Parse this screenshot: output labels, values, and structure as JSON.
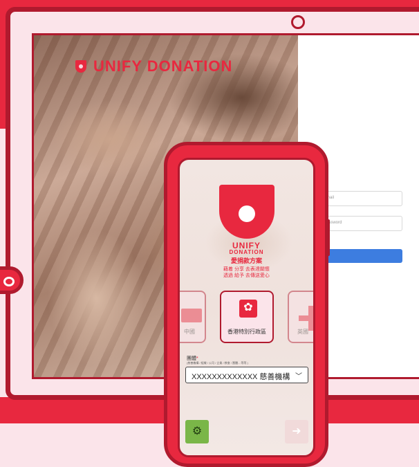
{
  "brand": {
    "logo_text": "UNIFY DONATION",
    "accent_color": "#e8283f",
    "dark_accent": "#b01a2e"
  },
  "login": {
    "email_placeholder": "Email",
    "password_placeholder": "Password"
  },
  "phone": {
    "brand_line1": "UNIFY",
    "brand_line2": "DONATION",
    "brand_line3": "愛捐款方案",
    "tagline1": "藉着 分享 去表達關懷",
    "tagline2": "透過 給予 去傳送愛心",
    "regions": [
      {
        "label": "中國",
        "icon": "china-flag-icon"
      },
      {
        "label": "香港特別行政區",
        "icon": "hong-kong-flag-icon"
      },
      {
        "label": "英國",
        "icon": "plus-cross-icon"
      }
    ],
    "field_label": "團體",
    "field_required": "*",
    "field_hint": "(慈善機構 / 組織 / 公司 / 企業 / 教會 / 團體....等等 )",
    "selected_org": "XXXXXXXXXXXXX 慈善機構",
    "settings_icon": "gear-icon",
    "next_icon": "arrow-right-icon"
  }
}
